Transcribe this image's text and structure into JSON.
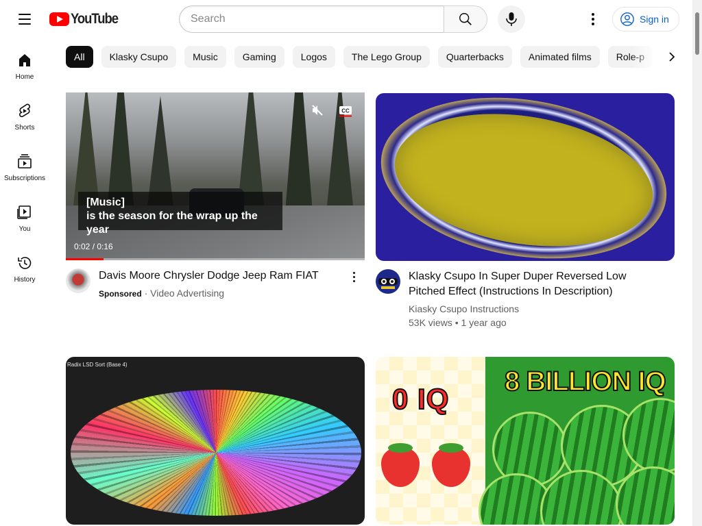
{
  "header": {
    "logo_text": "YouTube",
    "search_placeholder": "Search",
    "signin_label": "Sign in"
  },
  "sidebar": {
    "items": [
      {
        "label": "Home",
        "icon": "home-icon"
      },
      {
        "label": "Shorts",
        "icon": "shorts-icon"
      },
      {
        "label": "Subscriptions",
        "icon": "subscriptions-icon"
      },
      {
        "label": "You",
        "icon": "you-icon"
      },
      {
        "label": "History",
        "icon": "history-icon"
      }
    ]
  },
  "chips": [
    "All",
    "Klasky Csupo",
    "Music",
    "Gaming",
    "Logos",
    "The Lego Group",
    "Quarterbacks",
    "Animated films",
    "Role-p"
  ],
  "videos": [
    {
      "title": "Davis Moore Chrysler Dodge Jeep Ram FIAT",
      "sponsored": "Sponsored",
      "channel": "Video Advertising",
      "caption_line1": "[Music]",
      "caption_line2": "is the season for the wrap up the year",
      "time": "0:02 / 0:16",
      "progress": 0.125
    },
    {
      "title": "Klasky Csupo In Super Duper Reversed Low Pitched Effect (Instructions In Description)",
      "channel": "Kiasky Csupo Instructions",
      "stats": "53K views • 1 year ago"
    },
    {
      "thumb_label": "Radix LSD Sort (Base 4)"
    },
    {
      "thumb_text_left": "0 IQ",
      "thumb_text_right": "8 BILLION IQ"
    }
  ],
  "colors": {
    "brand_red": "#ff0000",
    "link_blue": "#065fd4",
    "chip_bg": "#f2f2f2",
    "chip_active_bg": "#0f0f0f"
  }
}
